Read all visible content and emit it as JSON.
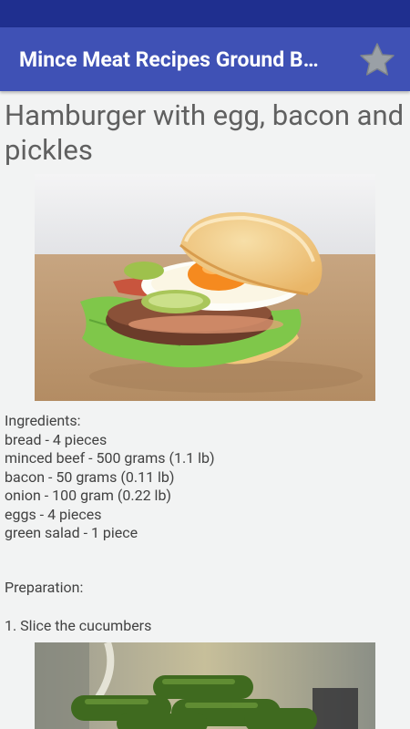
{
  "app_bar": {
    "title": "Mince Meat Recipes Ground Beef Recipes",
    "favorite_icon": "star-icon"
  },
  "recipe": {
    "title": "Hamburger with egg, bacon and pickles",
    "ingredients_heading": "Ingredients:",
    "ingredients": [
      "bread - 4 pieces",
      "minced beef - 500 grams (1.1 lb)",
      "bacon - 50 grams (0.11 lb)",
      "onion - 100 gram (0.22 lb)",
      "eggs - 4 pieces",
      "green salad - 1 piece"
    ],
    "preparation_heading": "Preparation:",
    "steps": [
      "1. Slice the cucumbers"
    ]
  },
  "colors": {
    "status_bar": "#1f2f8f",
    "app_bar": "#3f51b5",
    "background": "#f2f3f3",
    "text": "#424242"
  }
}
